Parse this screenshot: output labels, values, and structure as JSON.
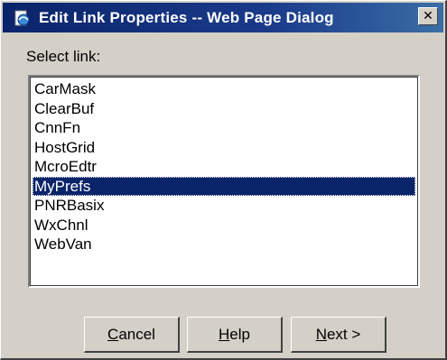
{
  "window": {
    "title": "Edit Link Properties -- Web Page Dialog",
    "close_glyph": "✕",
    "icon": "ie-page-icon"
  },
  "content": {
    "select_label": "Select link:",
    "links": [
      "CarMask",
      "ClearBuf",
      "CnnFn",
      "HostGrid",
      "McroEdtr",
      "MyPrefs",
      "PNRBasix",
      "WxChnl",
      "WebVan"
    ],
    "selected": "MyPrefs"
  },
  "buttons": {
    "cancel": {
      "hotkey": "C",
      "rest": "ancel"
    },
    "help": {
      "hotkey": "H",
      "rest": "elp"
    },
    "next": {
      "text": "N",
      "rest": "ext >"
    }
  },
  "colors": {
    "dialog_bg": "#d4d0c8",
    "titlebar": "#0a246a",
    "selection": "#0a246a"
  }
}
